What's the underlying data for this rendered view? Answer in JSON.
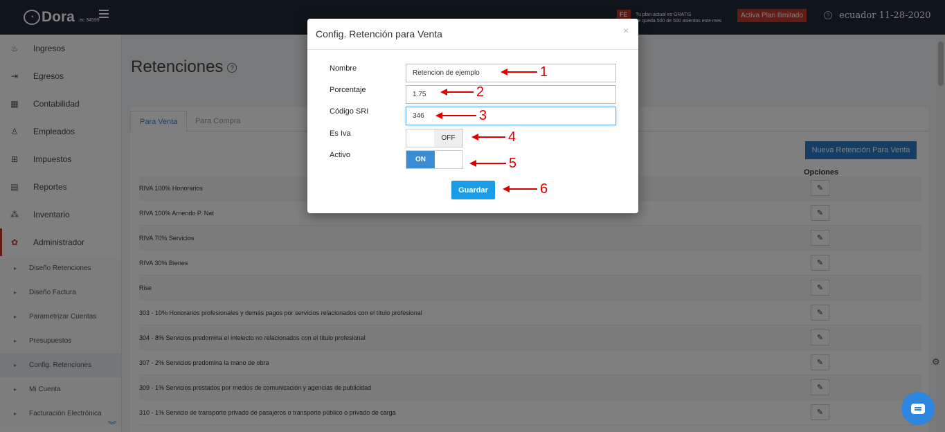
{
  "topbar": {
    "brand": "Dora",
    "brand_suffix": ".ec 34599",
    "fe_badge": "FE",
    "plan_line1": "Tu plan actual es GRATIS",
    "plan_line2": "Te queda 500 de 500 asientos este mes",
    "activate_label": "Activa Plan Ilimitado",
    "help_glyph": "?",
    "date_text": "ecuador 11-28-2020"
  },
  "sidebar": {
    "items": [
      {
        "label": "Ingresos",
        "icon": "♨"
      },
      {
        "label": "Egresos",
        "icon": "⇥"
      },
      {
        "label": "Contabilidad",
        "icon": "▦"
      },
      {
        "label": "Empleados",
        "icon": "♙"
      },
      {
        "label": "Impuestos",
        "icon": "⊞"
      },
      {
        "label": "Reportes",
        "icon": "▤"
      },
      {
        "label": "Inventario",
        "icon": "⁂"
      },
      {
        "label": "Administrador",
        "icon": "✿"
      }
    ],
    "subitems": [
      "Diseño Retenciones",
      "Diseño Factura",
      "Parametrizar Cuentas",
      "Presupuestos",
      "Config. Retenciones",
      "Mi Cuenta",
      "Facturación Electrónica"
    ],
    "more_glyph": "︾"
  },
  "main": {
    "title": "Retenciones",
    "tabs": [
      "Para Venta",
      "Para Compra"
    ],
    "new_button": "Nueva Retención Para Venta",
    "options_header": "Opciones",
    "rows": [
      "RIVA 100% Honorarios",
      "RIVA 100% Arriendo P. Nat",
      "RIVA 70% Servicios",
      "RIVA 30% Bienes",
      "Rise",
      "303 - 10% Honorarios profesionales y demás pagos por servicios relacionados con el título profesional",
      "304 - 8% Servicios predomina el intelecto no relacionados con el título profesional",
      "307 - 2% Servicios predomina la mano de obra",
      "309 - 1% Servicios prestados por medios de comunicación y agencias de publicidad",
      "310 - 1% Servicio de transporte privado de pasajeros o transporte público o privado de carga"
    ],
    "edit_glyph": "✎"
  },
  "modal": {
    "title": "Config. Retención para Venta",
    "close_glyph": "×",
    "fields": {
      "nombre_label": "Nombre",
      "nombre_value": "Retencion de ejemplo",
      "porcentaje_label": "Porcentaje",
      "porcentaje_value": "1.75",
      "codigo_label": "Código SRI",
      "codigo_value": "346",
      "esiva_label": "Es Iva",
      "esiva_state": "OFF",
      "activo_label": "Activo",
      "activo_state": "ON"
    },
    "save_label": "Guardar"
  },
  "annotations": [
    "1",
    "2",
    "3",
    "4",
    "5",
    "6"
  ],
  "colors": {
    "accent": "#1a9ce8",
    "annotation": "#e00000",
    "topbar": "#1f2a35",
    "danger": "#c0392b"
  },
  "floating": {
    "gear_glyph": "⚙"
  }
}
